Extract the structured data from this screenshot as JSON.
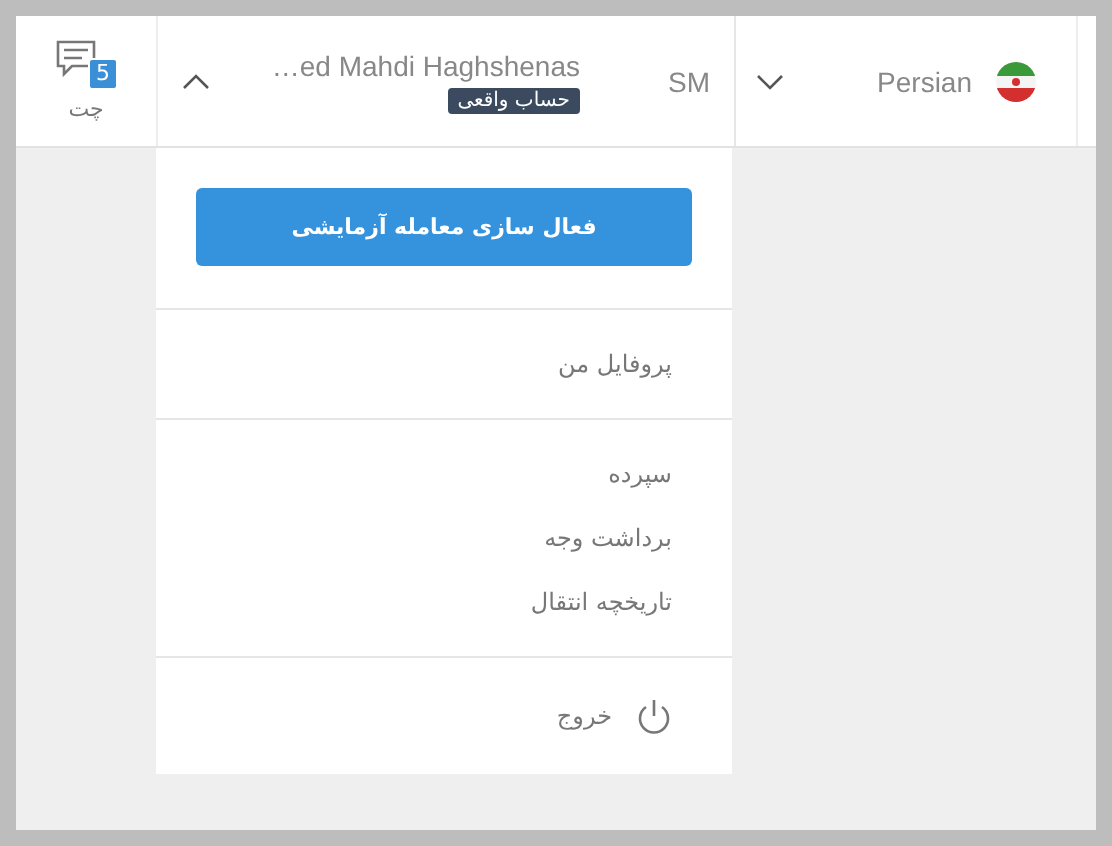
{
  "header": {
    "chat": {
      "label": "چت",
      "badge": "5"
    },
    "user": {
      "name": "…ed Mahdi Haghshenas",
      "account_badge": "حساب واقعی",
      "initials": "SM",
      "expanded": true
    },
    "language": {
      "label": "Persian",
      "expanded": false
    }
  },
  "menu": {
    "primary_button": "فعال سازی معامله آزمایشی",
    "sections": [
      [
        {
          "label": "پروفایل من",
          "kind": "link"
        }
      ],
      [
        {
          "label": "سپرده",
          "kind": "link"
        },
        {
          "label": "برداشت وجه",
          "kind": "link"
        },
        {
          "label": "تاریخچه انتقال",
          "kind": "link"
        }
      ],
      [
        {
          "label": "خروج",
          "kind": "logout"
        }
      ]
    ]
  }
}
